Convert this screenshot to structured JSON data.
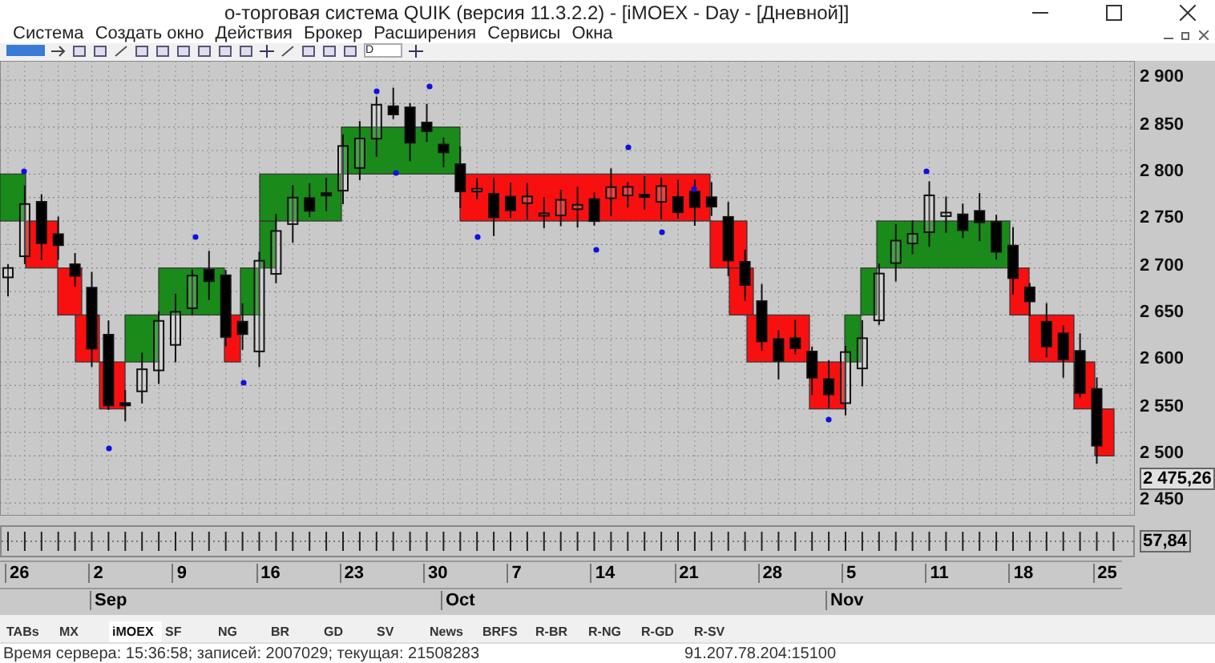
{
  "window": {
    "title": "о-торговая система QUIK (версия 11.3.2.2) - [iMOEX - Day - [Дневной]]"
  },
  "menu": [
    "Система",
    "Создать окно",
    "Действия",
    "Брокер",
    "Расширения",
    "Сервисы",
    "Окна"
  ],
  "toolbar": {
    "interval": "D"
  },
  "chart": {
    "price_labels": [
      "2 900",
      "2 850",
      "2 800",
      "2 750",
      "2 700",
      "2 650",
      "2 600",
      "2 550",
      "2 500",
      "2 450"
    ],
    "last_price": "2 475,26",
    "date_labels": [
      "26",
      "2",
      "9",
      "16",
      "23",
      "30",
      "7",
      "14",
      "21",
      "28",
      "5",
      "11",
      "18",
      "25"
    ],
    "months": [
      "Sep",
      "Oct",
      "Nov"
    ]
  },
  "indicator": {
    "value": "57,84"
  },
  "tabs": [
    {
      "label": "TABs",
      "selected": false
    },
    {
      "label": "MX",
      "selected": false
    },
    {
      "label": "iMOEX",
      "selected": true
    },
    {
      "label": "SF",
      "selected": false
    },
    {
      "label": "NG",
      "selected": false
    },
    {
      "label": "BR",
      "selected": false
    },
    {
      "label": "GD",
      "selected": false
    },
    {
      "label": "SV",
      "selected": false
    },
    {
      "label": "News",
      "selected": false
    },
    {
      "label": "BRFS",
      "selected": false
    },
    {
      "label": "R-BR",
      "selected": false
    },
    {
      "label": "R-NG",
      "selected": false
    },
    {
      "label": "R-GD",
      "selected": false
    },
    {
      "label": "R-SV",
      "selected": false
    }
  ],
  "status_bar": {
    "server": "Время сервера: 15:36:58; записей: 2007029; текущая: 21508283",
    "address": "91.207.78.204:15100"
  }
}
